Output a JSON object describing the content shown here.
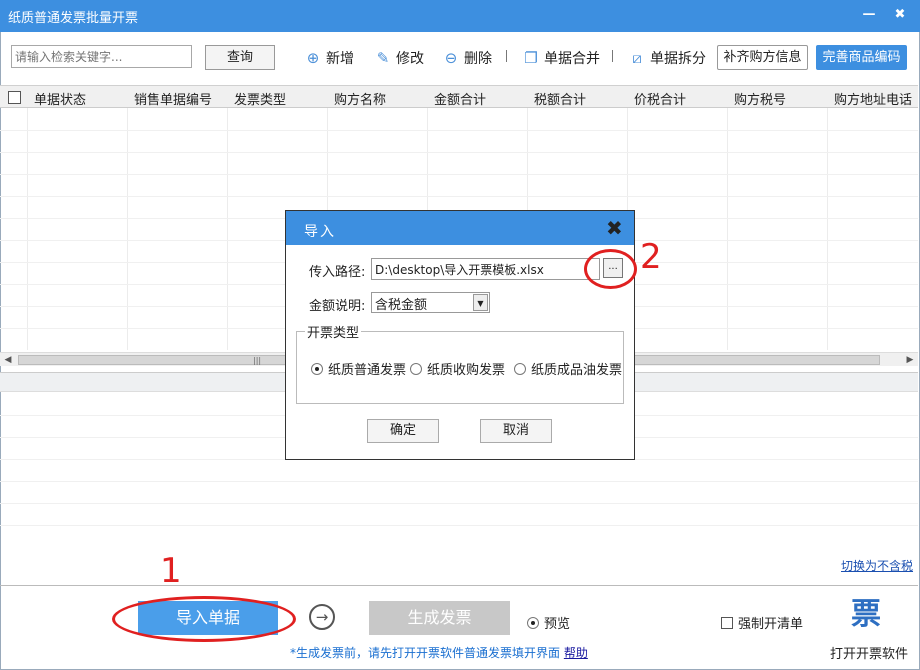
{
  "window": {
    "title": "纸质普通发票批量开票",
    "minimize": "—",
    "close": "✖"
  },
  "toolbar": {
    "search_placeholder": "请输入检索关键字...",
    "query_label": "查询",
    "add_label": "新增",
    "edit_label": "修改",
    "delete_label": "删除",
    "merge_label": "单据合并",
    "split_label": "单据拆分",
    "fill_buyer_label": "补齐购方信息",
    "complete_goods_label": "完善商品编码"
  },
  "grid": {
    "columns": [
      "单据状态",
      "销售单据编号",
      "发票类型",
      "购方名称",
      "金额合计",
      "税额合计",
      "价税合计",
      "购方税号",
      "购方地址电话"
    ]
  },
  "bottom": {
    "switch_link": "切换为不含税",
    "import_label": "导入单据",
    "generate_label": "生成发票",
    "preview_label": "预览",
    "force_list_label": "强制开清单",
    "open_software_label": "打开开票软件",
    "open_software_icon": "票",
    "hint_text": "*生成发票前，请先打开开票软件普通发票填开界面",
    "help_link": "帮助"
  },
  "dialog": {
    "title": "导入",
    "path_label": "传入路径:",
    "path_value": "D:\\desktop\\导入开票模板.xlsx",
    "browse_label": "...",
    "amount_label": "金额说明:",
    "amount_value": "含税金额",
    "invoice_type_legend": "开票类型",
    "options": [
      "纸质普通发票",
      "纸质收购发票",
      "纸质成品油发票"
    ],
    "selected_option": 0,
    "ok_label": "确定",
    "cancel_label": "取消"
  },
  "annotations": {
    "step1": "1",
    "step2": "2",
    "color": "#e02020"
  },
  "colors": {
    "titlebar": "#3d8fe0",
    "primary_button": "#4a9eea",
    "disabled_button": "#c8c8c8",
    "link": "#1a6fd0"
  }
}
